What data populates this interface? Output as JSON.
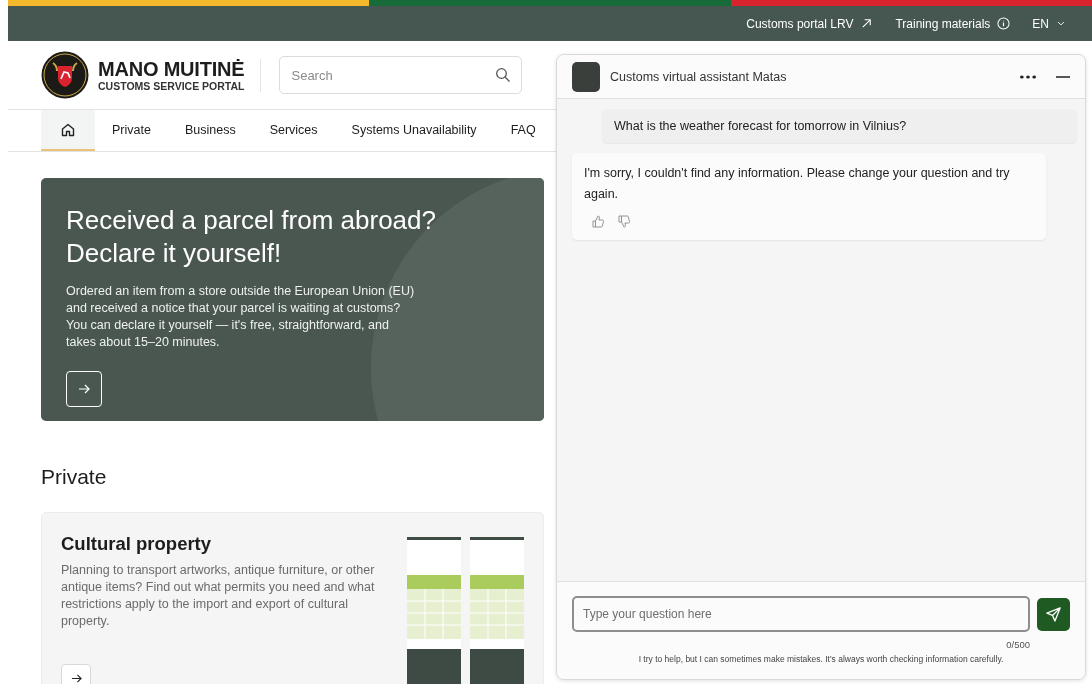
{
  "top_links": [
    {
      "label": "Customs portal LRV",
      "kind": "external"
    },
    {
      "label": "Training materials",
      "kind": "info"
    },
    {
      "label": "EN",
      "kind": "dropdown"
    }
  ],
  "header": {
    "brand_title": "MANO MUITINĖ",
    "brand_subtitle": "CUSTOMS SERVICE PORTAL",
    "search": {
      "placeholder": "Search"
    }
  },
  "nav": [
    {
      "kind": "home",
      "selected": true
    },
    {
      "kind": "link",
      "label": "Private",
      "selected": false
    },
    {
      "kind": "link",
      "label": "Business",
      "selected": false
    },
    {
      "kind": "link",
      "label": "Services",
      "selected": false
    },
    {
      "kind": "link",
      "label": "Systems Unavailability",
      "selected": false
    },
    {
      "kind": "link",
      "label": "FAQ",
      "selected": false
    }
  ],
  "hero": {
    "title": "Received a parcel from abroad? Declare it yourself!",
    "text": "Ordered an item from a store outside the European Union (EU) and received a notice that your parcel is waiting at customs? You can declare it yourself — it's free, straightforward, and takes about 15–20 minutes."
  },
  "section_title": "Private",
  "cards": [
    {
      "title": "Cultural property",
      "description": "Planning to transport artworks, antique furniture, or other antique items? Find out what permits you need and what restrictions apply to the import and export of cultural property."
    }
  ],
  "chat": {
    "title": "Customs virtual assistant Matas",
    "messages": [
      {
        "kind": "user",
        "text": "What is the weather forecast for tomorrow in Vilnius?"
      },
      {
        "kind": "bot",
        "text": "I'm sorry, I couldn't find any information. Please change your question and try again."
      }
    ],
    "input": {
      "placeholder": "Type your question here"
    },
    "counter": "0/500",
    "disclaimer": "I try to help, but I can sometimes make mistakes. It's always worth checking information carefully."
  }
}
